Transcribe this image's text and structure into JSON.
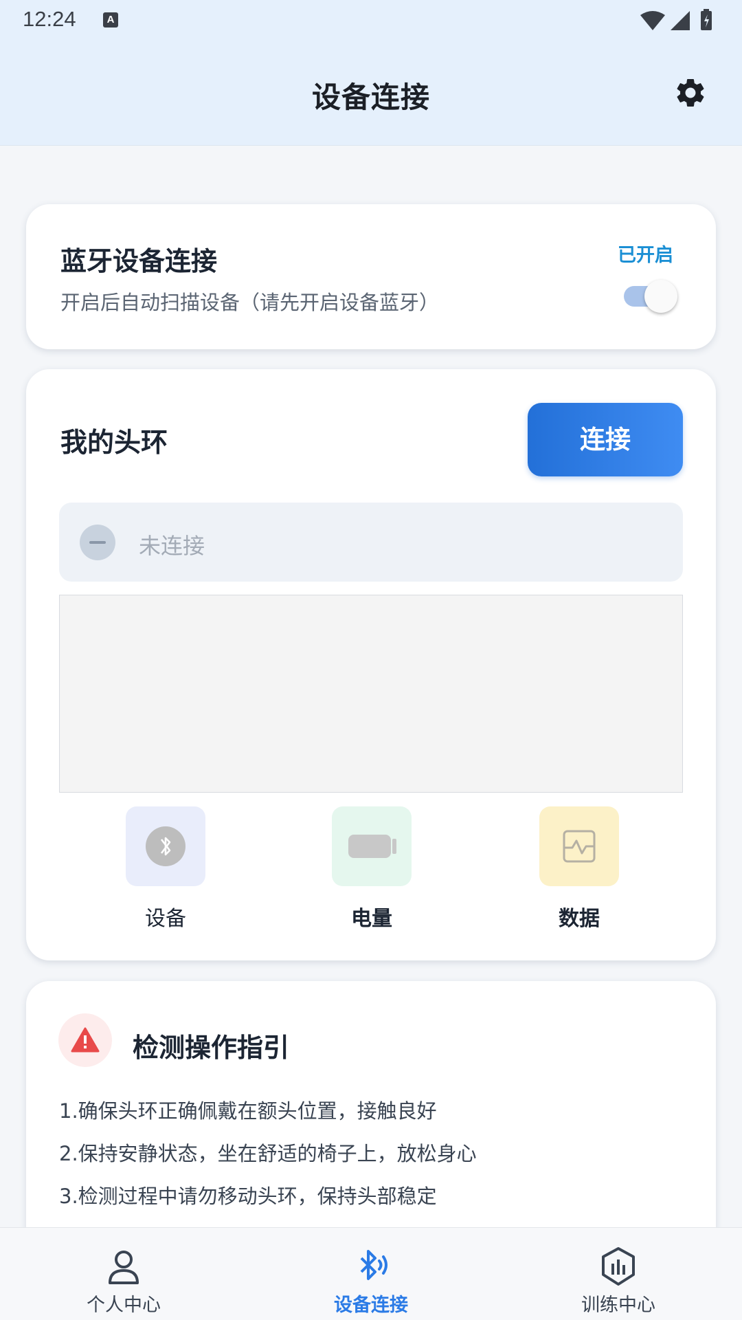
{
  "status_bar": {
    "time": "12:24",
    "notification_glyph": "A"
  },
  "header": {
    "title": "设备连接",
    "settings_icon": "gear-icon"
  },
  "bluetooth_card": {
    "title": "蓝牙设备连接",
    "subtitle": "开启后自动扫描设备（请先开启设备蓝牙）",
    "status": "已开启",
    "toggle_on": true
  },
  "headband_card": {
    "title": "我的头环",
    "connect_label": "连接",
    "connection_status": "未连接",
    "metrics": [
      {
        "label": "设备",
        "icon": "bluetooth-icon",
        "color": "#e9edfb"
      },
      {
        "label": "电量",
        "icon": "battery-icon",
        "color": "#e5f7ee"
      },
      {
        "label": "数据",
        "icon": "data-chart-icon",
        "color": "#fcf1c8"
      }
    ]
  },
  "guide_card": {
    "title": "检测操作指引",
    "icon": "warning-icon",
    "lines": [
      "1.确保头环正确佩戴在额头位置，接触良好",
      "2.保持安静状态，坐在舒适的椅子上，放松身心",
      "3.检测过程中请勿移动头环，保持头部稳定"
    ]
  },
  "bottom_nav": {
    "items": [
      {
        "label": "个人中心",
        "icon": "person-icon",
        "active": false
      },
      {
        "label": "设备连接",
        "icon": "bluetooth-signal-icon",
        "active": true
      },
      {
        "label": "训练中心",
        "icon": "chart-hexagon-icon",
        "active": false
      }
    ],
    "active_color": "#2b7be6"
  }
}
